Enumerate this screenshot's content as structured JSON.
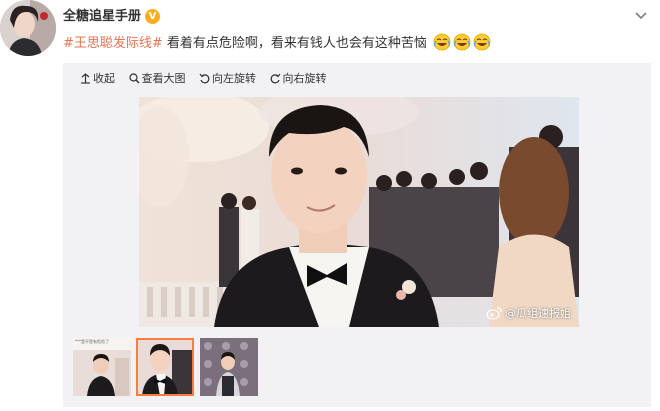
{
  "post": {
    "author": "全糖追星手册",
    "verified_badge": "V",
    "topic": "#王思聪发际线#",
    "text": " 看着有点危险啊，看来有钱人也会有这种苦恼",
    "emoji_count": 3
  },
  "toolbar": {
    "collapse": "收起",
    "view_large": "查看大图",
    "rotate_left": "向左旋转",
    "rotate_right": "向右旋转"
  },
  "photo": {
    "watermark": "@瓜组速报姐"
  },
  "thumbnails": {
    "first_caption": "***是不是有危险了",
    "selected_index": 2
  },
  "colors": {
    "topic": "#eb7350",
    "badge": "#ffad1f",
    "active_thumb_border": "#fa7d3c",
    "media_bg": "#f2f2f5"
  }
}
